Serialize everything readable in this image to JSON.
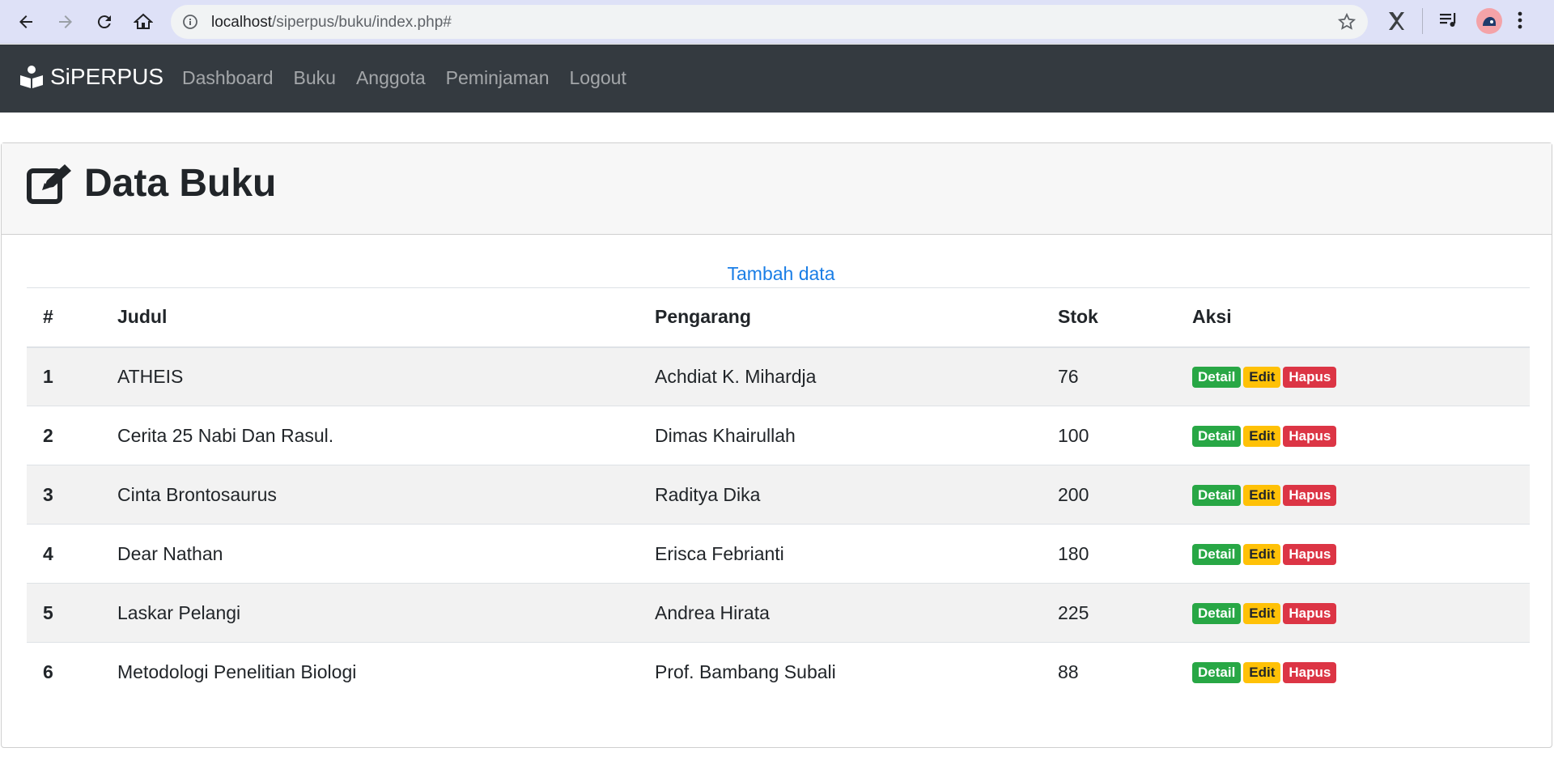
{
  "browser": {
    "url_host": "localhost",
    "url_path": "/siperpus/buku/index.php#"
  },
  "navbar": {
    "brand": "SiPERPUS",
    "links": [
      "Dashboard",
      "Buku",
      "Anggota",
      "Peminjaman",
      "Logout"
    ]
  },
  "page": {
    "title": "Data Buku",
    "add_link": "Tambah data"
  },
  "table": {
    "headers": [
      "#",
      "Judul",
      "Pengarang",
      "Stok",
      "Aksi"
    ],
    "rows": [
      {
        "no": "1",
        "judul": "ATHEIS",
        "pengarang": "Achdiat K. Mihardja",
        "stok": "76"
      },
      {
        "no": "2",
        "judul": "Cerita 25 Nabi Dan Rasul.",
        "pengarang": "Dimas Khairullah",
        "stok": "100"
      },
      {
        "no": "3",
        "judul": "Cinta Brontosaurus",
        "pengarang": "Raditya Dika",
        "stok": "200"
      },
      {
        "no": "4",
        "judul": "Dear Nathan",
        "pengarang": "Erisca Febrianti",
        "stok": "180"
      },
      {
        "no": "5",
        "judul": "Laskar Pelangi",
        "pengarang": "Andrea Hirata",
        "stok": "225"
      },
      {
        "no": "6",
        "judul": "Metodologi Penelitian Biologi",
        "pengarang": "Prof. Bambang Subali",
        "stok": "88"
      }
    ],
    "actions": {
      "detail": "Detail",
      "edit": "Edit",
      "hapus": "Hapus"
    }
  },
  "colors": {
    "navbar": "#343a40",
    "detail": "#28a745",
    "edit": "#ffc107",
    "hapus": "#dc3545",
    "link": "#1a7ee6"
  }
}
